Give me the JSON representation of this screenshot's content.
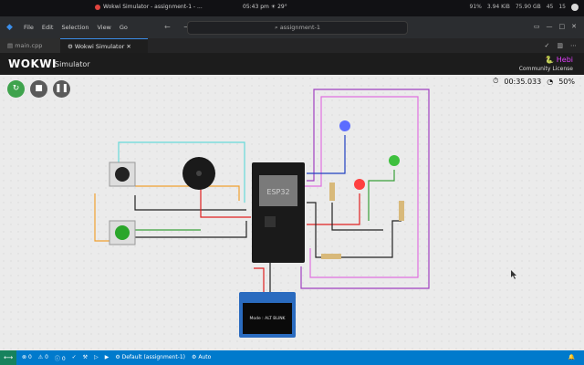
{
  "topbar": {
    "window_title": "Wokwi Simulator - assignment-1 - ...",
    "clock": "05:43 pm",
    "weather": "29°",
    "battery": "91%",
    "net": "3.94 KiB",
    "cpu": "75.90 GB",
    "volume": "45",
    "workspace": "15"
  },
  "titlebar": {
    "menu": [
      "File",
      "Edit",
      "Selection",
      "View",
      "Go"
    ],
    "nav": "← →",
    "search": "assignment-1"
  },
  "tabs": [
    {
      "label": "main.cpp",
      "icon": "file-icon"
    },
    {
      "label": "Wokwi Simulator",
      "icon": "wokwi-icon"
    }
  ],
  "wokwi": {
    "logo": "WOKWI",
    "title": "Simulator",
    "user": "Hebi",
    "license": "Community License",
    "timer": "00:35.033",
    "speed": "50%"
  },
  "circuit": {
    "esp32_label": "ESP32",
    "oled_text": "Mode : ALT BLINK"
  },
  "colors": {
    "accent": "#007acc",
    "run": "#3fa34d",
    "control": "#5a5a5a",
    "user": "#e040fb"
  },
  "statusbar": {
    "remote_icon": "remote-icon",
    "errors": "0",
    "warnings": "0",
    "info": "0",
    "profile": "Default (assignment-1)",
    "build": "Auto"
  }
}
